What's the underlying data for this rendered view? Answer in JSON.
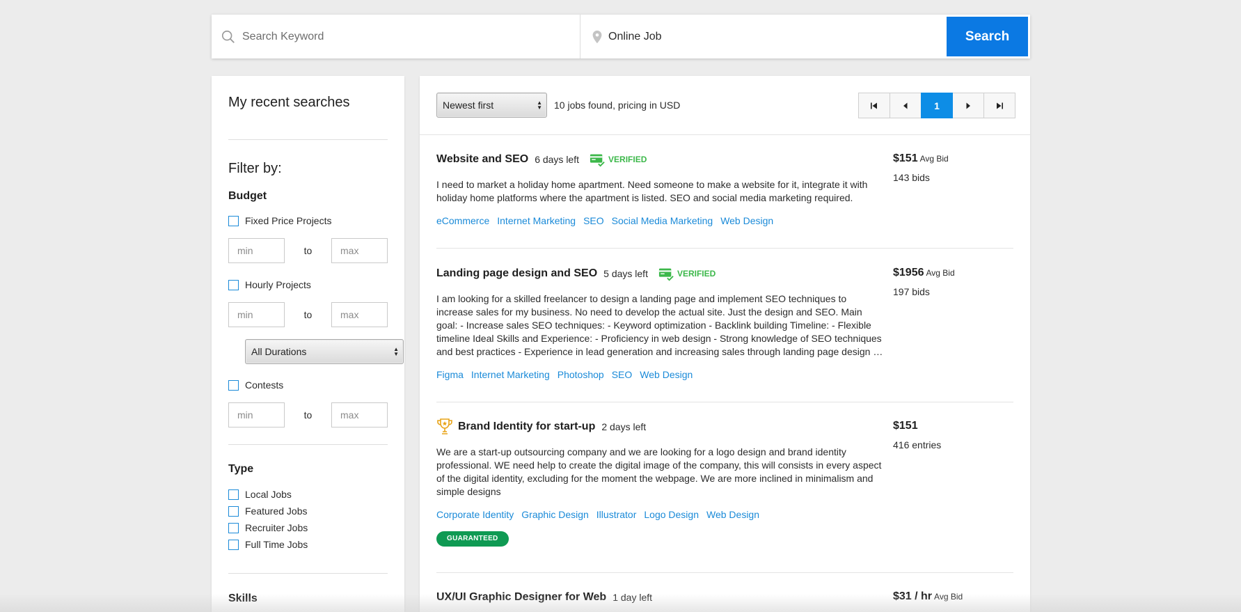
{
  "search": {
    "keyword_placeholder": "Search Keyword",
    "keyword_value": "",
    "location_value": "Online Job",
    "button_label": "Search"
  },
  "sidebar": {
    "recent_title": "My recent searches",
    "filter_title": "Filter by:",
    "budget": {
      "title": "Budget",
      "fixed_label": "Fixed Price Projects",
      "hourly_label": "Hourly Projects",
      "contests_label": "Contests",
      "min_placeholder": "min",
      "max_placeholder": "max",
      "to_label": "to",
      "duration_selected": "All Durations"
    },
    "type": {
      "title": "Type",
      "items": [
        "Local Jobs",
        "Featured Jobs",
        "Recruiter Jobs",
        "Full Time Jobs"
      ]
    },
    "skills_title": "Skills"
  },
  "toolbar": {
    "sort_selected": "Newest first",
    "found_text": "10 jobs found, pricing in USD",
    "current_page": "1"
  },
  "jobs": [
    {
      "title": "Website and SEO",
      "days_left": "6 days left",
      "verified_label": "VERIFIED",
      "description": "I need to market a holiday home apartment. Need someone to make a website for it, integrate it with holiday home platforms where the apartment is listed. SEO and social media marketing required.",
      "tags": [
        "eCommerce",
        "Internet Marketing",
        "SEO",
        "Social Media Marketing",
        "Web Design"
      ],
      "price": "$151",
      "price_unit": "Avg Bid",
      "bids": "143 bids"
    },
    {
      "title": "Landing page design and SEO",
      "days_left": "5 days left",
      "verified_label": "VERIFIED",
      "description": "I am looking for a skilled freelancer to design a landing page and implement SEO techniques to increase sales for my business. No need to develop the actual site. Just the design and SEO. Main goal: - Increase sales SEO techniques: - Keyword optimization - Backlink building Timeline: - Flexible timeline Ideal Skills and Experience: - Proficiency in web design - Strong knowledge of SEO techniques and best practices - Experience in lead generation and increasing sales through landing page design - Creativity and attention to detail",
      "tags": [
        "Figma",
        "Internet Marketing",
        "Photoshop",
        "SEO",
        "Web Design"
      ],
      "price": "$1956",
      "price_unit": "Avg Bid",
      "bids": "197 bids"
    },
    {
      "title": "Brand Identity for start-up",
      "days_left": "2 days left",
      "description": "We are a start-up outsourcing company and we are looking for a logo design and brand identity professional. WE need help to create the digital image of the company, this will consists in every aspect of the digital identity, excluding for the moment the webpage. We are more inclined in minimalism and simple designs",
      "tags": [
        "Corporate Identity",
        "Graphic Design",
        "Illustrator",
        "Logo Design",
        "Web Design"
      ],
      "price": "$151",
      "bids": "416 entries",
      "badge": "GUARANTEED"
    },
    {
      "title": "UX/UI Graphic Designer for Web",
      "days_left": "1 day left",
      "price": "$31 / hr",
      "price_unit": "Avg Bid"
    }
  ],
  "colors": {
    "accent": "#0b79e3",
    "link": "#1a8ad8",
    "verified": "#3cb84a",
    "guaranteed": "#0f9a53",
    "trophy": "#e8a317"
  }
}
